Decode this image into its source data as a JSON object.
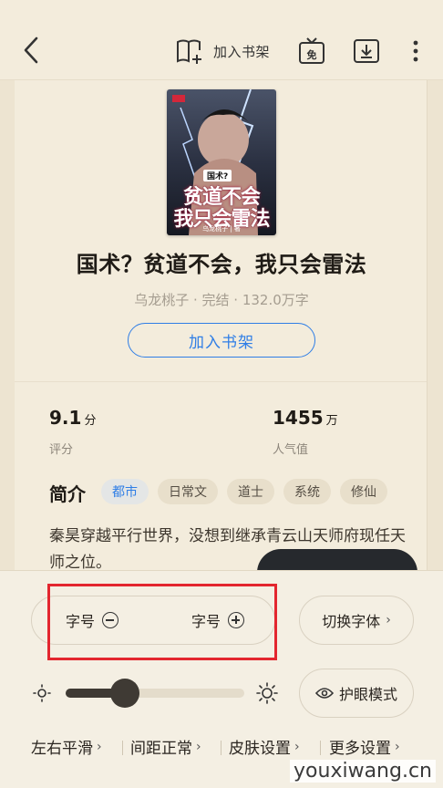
{
  "header": {
    "add_shelf_label": "加入书架"
  },
  "book": {
    "cover_tag": "国术?",
    "cover_line1": "贫道不会",
    "cover_line2": "我只会雷法",
    "cover_author": "乌龙桃子 | 著",
    "title": "国术？贫道不会，我只会雷法",
    "meta": "乌龙桃子 · 完结 · 132.0万字",
    "shelf_button": "加入书架"
  },
  "stats": {
    "rating_value": "9.1",
    "rating_unit": "分",
    "rating_label": "评分",
    "popularity_value": "1455",
    "popularity_unit": "万",
    "popularity_label": "人气值"
  },
  "intro": {
    "heading": "简介",
    "tags": [
      "都市",
      "日常文",
      "道士",
      "系统",
      "修仙"
    ],
    "text": "秦昊穿越平行世界，没想到继承青云山天师府现任天师之位。"
  },
  "panel": {
    "font_smaller": "字号",
    "font_larger": "字号",
    "switch_font": "切换字体",
    "eye_mode": "护眼模式",
    "brightness": 0.33,
    "bottom": [
      "左右平滑",
      "间距正常",
      "皮肤设置",
      "更多设置"
    ]
  },
  "watermark": "youxiwang.cn",
  "colors": {
    "accent": "#2f7ee6",
    "highlight_box": "#e3262f",
    "background": "#f3ecdc"
  }
}
